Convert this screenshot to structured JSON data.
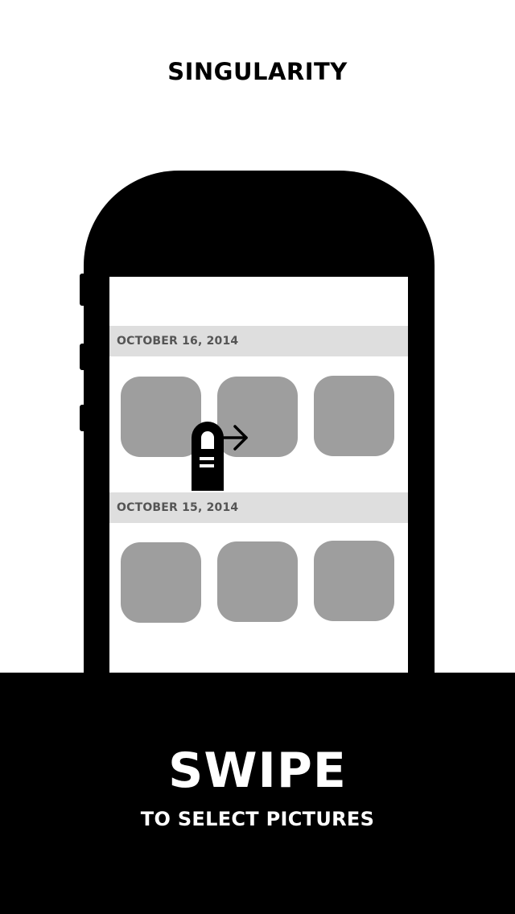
{
  "app": {
    "title": "SINGULARITY"
  },
  "illustration": {
    "sections": [
      {
        "date": "OCTOBER 16, 2014",
        "thumbnails": 3
      },
      {
        "date": "OCTOBER 15, 2014",
        "thumbnails": 3
      }
    ],
    "gesture_icon": "swipe-right-finger-icon"
  },
  "tutorial": {
    "headline": "SWIPE",
    "subline": "TO SELECT PICTURES"
  },
  "colors": {
    "background": "#ffffff",
    "phone": "#000000",
    "section_header": "#dedede",
    "section_text": "#555555",
    "thumbnail": "#9e9e9e",
    "panel": "#000000",
    "panel_text": "#ffffff"
  }
}
